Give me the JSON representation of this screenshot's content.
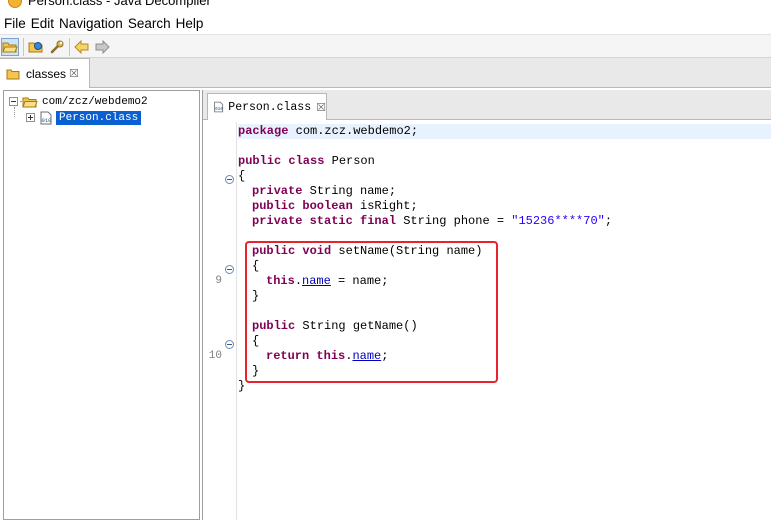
{
  "window": {
    "title": "Person.class - Java Decompiler"
  },
  "menu": {
    "items": [
      "File",
      "Edit",
      "Navigation",
      "Search",
      "Help"
    ]
  },
  "toolbar": {
    "buttons": [
      "open-file-icon",
      "open-type-icon",
      "wrench-icon",
      "back-arrow-icon",
      "forward-arrow-icon"
    ]
  },
  "outer_tab": {
    "label": "classes",
    "close": "☒"
  },
  "tree": {
    "package": "com/zcz/webdemo2",
    "class_file": "Person.class"
  },
  "editor_tab": {
    "label": "Person.class",
    "close": "☒"
  },
  "gutter": {
    "line_numbers": [
      "9",
      "10"
    ]
  },
  "code": {
    "package_kw": "package",
    "package_name": " com.zcz.webdemo2;",
    "class_kw": "public class",
    "class_name": " Person",
    "open_brace": "{",
    "field1_kw": "private",
    "field1_rest": " String name;",
    "field2_kw": "public boolean",
    "field2_rest": " isRight;",
    "field3_kw": "private static final",
    "field3_type": " String phone = ",
    "field3_value": "\"15236****70\"",
    "field3_end": ";",
    "m1_kw": "public void",
    "m1_sig": " setName(String name)",
    "m1_open": "{",
    "m1_this": "this",
    "m1_dot": ".",
    "m1_field": "name",
    "m1_rest": " = name;",
    "m1_close": "}",
    "m2_kw": "public",
    "m2_sig": " String getName()",
    "m2_open": "{",
    "m2_ret": "return",
    "m2_this": " this",
    "m2_dot": ".",
    "m2_field": "name",
    "m2_semi": ";",
    "m2_close": "}",
    "class_close": "}"
  },
  "colors": {
    "keyword": "#7f0055",
    "string": "#2a00ff",
    "field": "#0000c0",
    "highlight_box": "#e8232d",
    "selection": "#0a5fd1"
  }
}
